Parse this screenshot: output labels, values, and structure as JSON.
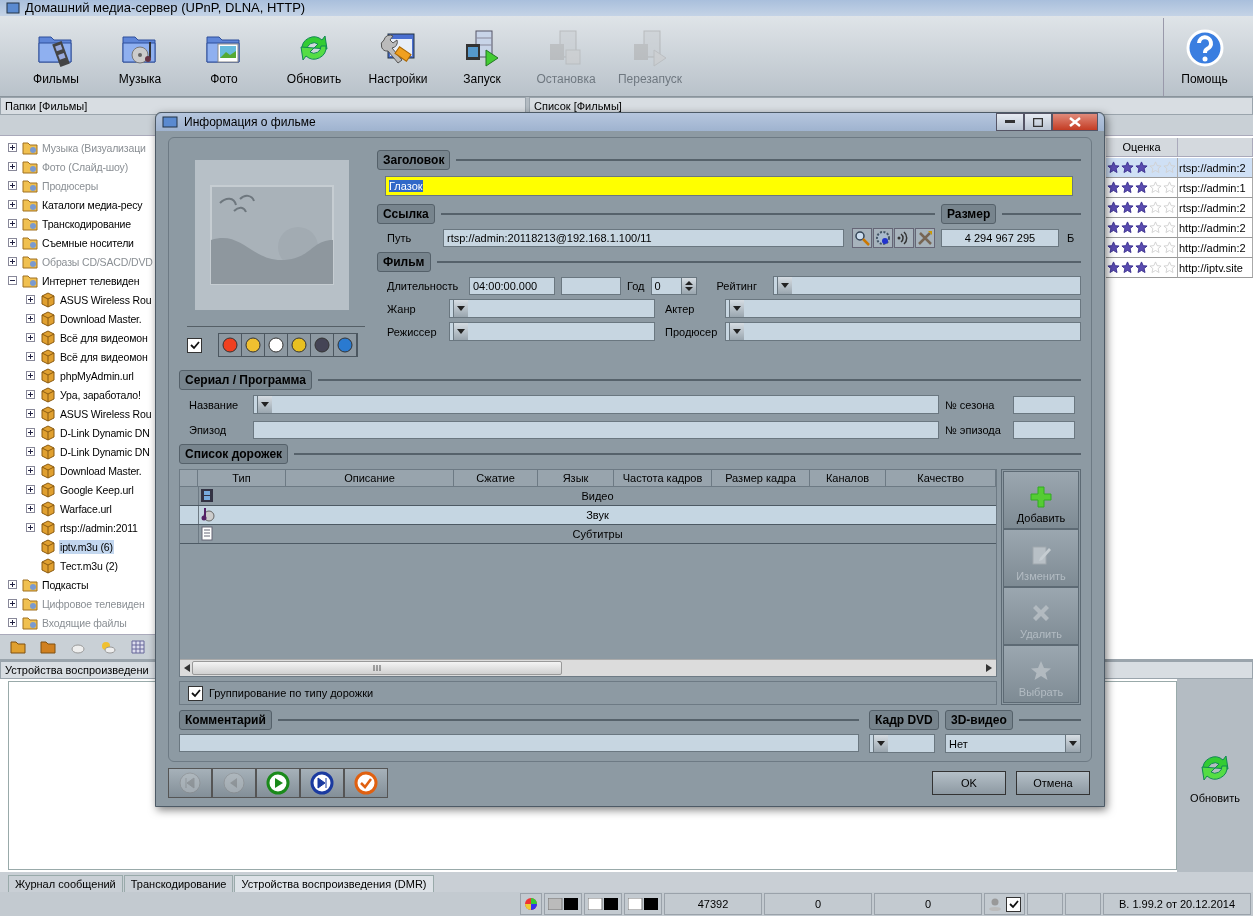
{
  "app": {
    "title": "Домашний медиа-сервер (UPnP, DLNA, HTTP)"
  },
  "toolbar": [
    {
      "label": "Фильмы",
      "disabled": false
    },
    {
      "label": "Музыка",
      "disabled": false
    },
    {
      "label": "Фото",
      "disabled": false
    },
    {
      "label": "Обновить",
      "disabled": false
    },
    {
      "label": "Настройки",
      "disabled": false
    },
    {
      "label": "Запуск",
      "disabled": false
    },
    {
      "label": "Остановка",
      "disabled": true
    },
    {
      "label": "Перезапуск",
      "disabled": true
    }
  ],
  "help_button": {
    "label": "Помощь"
  },
  "folders_panel": {
    "title": "Папки [Фильмы]",
    "tree": [
      {
        "label": "Музыка (Визуализаци",
        "dimmed": true,
        "expandable": true,
        "expanded": false,
        "selected": false
      },
      {
        "label": "Фото (Слайд-шоу)",
        "dimmed": true,
        "expandable": true,
        "expanded": false,
        "selected": false
      },
      {
        "label": "Продюсеры",
        "dimmed": true,
        "expandable": true,
        "expanded": false,
        "selected": false
      },
      {
        "label": "Каталоги медиа-ресу",
        "dimmed": false,
        "expandable": true,
        "expanded": false,
        "selected": false
      },
      {
        "label": "Транскодирование",
        "dimmed": false,
        "expandable": true,
        "expanded": false,
        "selected": false
      },
      {
        "label": "Съемные носители",
        "dimmed": false,
        "expandable": true,
        "expanded": false,
        "selected": false
      },
      {
        "label": "Образы CD/SACD/DVD",
        "dimmed": true,
        "expandable": true,
        "expanded": false,
        "selected": false
      },
      {
        "label": "Интернет телевиден",
        "dimmed": false,
        "expandable": true,
        "expanded": true,
        "selected": false,
        "children": [
          {
            "label": "ASUS Wireless Rou",
            "dimmed": false,
            "expandable": true,
            "expanded": false,
            "selected": false
          },
          {
            "label": "Download Master.",
            "dimmed": false,
            "expandable": true,
            "expanded": false,
            "selected": false
          },
          {
            "label": "Всё для видеомон",
            "dimmed": false,
            "expandable": true,
            "expanded": false,
            "selected": false
          },
          {
            "label": "Всё для видеомон",
            "dimmed": false,
            "expandable": true,
            "expanded": false,
            "selected": false
          },
          {
            "label": "phpMyAdmin.url",
            "dimmed": false,
            "expandable": true,
            "expanded": false,
            "selected": false
          },
          {
            "label": "Ура, заработало!",
            "dimmed": false,
            "expandable": true,
            "expanded": false,
            "selected": false
          },
          {
            "label": "ASUS Wireless Rou",
            "dimmed": false,
            "expandable": true,
            "expanded": false,
            "selected": false
          },
          {
            "label": "D-Link Dynamic DN",
            "dimmed": false,
            "expandable": true,
            "expanded": false,
            "selected": false
          },
          {
            "label": "D-Link Dynamic DN",
            "dimmed": false,
            "expandable": true,
            "expanded": false,
            "selected": false
          },
          {
            "label": "Download Master.",
            "dimmed": false,
            "expandable": true,
            "expanded": false,
            "selected": false
          },
          {
            "label": "Google Keep.url",
            "dimmed": false,
            "expandable": true,
            "expanded": false,
            "selected": false
          },
          {
            "label": "Warface.url",
            "dimmed": false,
            "expandable": true,
            "expanded": false,
            "selected": false
          },
          {
            "label": "rtsp://admin:2011",
            "dimmed": false,
            "expandable": true,
            "expanded": false,
            "selected": false
          },
          {
            "label": "iptv.m3u (6)",
            "dimmed": false,
            "expandable": false,
            "selected": true
          },
          {
            "label": "Тест.m3u (2)",
            "dimmed": false,
            "expandable": false,
            "selected": false
          }
        ]
      },
      {
        "label": "Подкасты",
        "dimmed": false,
        "expandable": true,
        "expanded": false,
        "selected": false
      },
      {
        "label": "Цифровое телевиден",
        "dimmed": true,
        "expandable": true,
        "expanded": false,
        "selected": false
      },
      {
        "label": "Входящие файлы",
        "dimmed": true,
        "expandable": true,
        "expanded": false,
        "selected": false
      }
    ]
  },
  "list_panel": {
    "title": "Список [Фильмы]",
    "columns": [
      "Оценка"
    ],
    "rows": [
      {
        "stars": 3,
        "link": "rtsp://admin:2",
        "selected": true
      },
      {
        "stars": 3,
        "link": "rtsp://admin:1",
        "selected": false
      },
      {
        "stars": 3,
        "link": "rtsp://admin:2",
        "selected": false
      },
      {
        "stars": 3,
        "link": "http://admin:2",
        "selected": false
      },
      {
        "stars": 3,
        "link": "http://admin:2",
        "selected": false
      },
      {
        "stars": 3,
        "link": "http://iptv.site",
        "selected": false
      }
    ]
  },
  "devices_panel": {
    "title": "Устройства воспроизведени",
    "refresh_button": "Обновить"
  },
  "bottom_tabs": [
    {
      "label": "Журнал сообщений",
      "selected": false
    },
    {
      "label": "Транскодирование",
      "selected": false
    },
    {
      "label": "Устройства воспроизведения (DMR)",
      "selected": true
    }
  ],
  "status_bar": {
    "counter_1": "47392",
    "counter_2": "0",
    "counter_3": "0",
    "checked": true,
    "version": "В. 1.99.2 от 20.12.2014"
  },
  "dialog": {
    "title": "Информация о фильме",
    "auto_fill_checked": true,
    "heading_section": {
      "label": "Заголовок",
      "value": "Глазок"
    },
    "link_section": {
      "label": "Ссылка",
      "path_label": "Путь",
      "path": "rtsp://admin:20118213@192.168.1.100/11"
    },
    "size_section": {
      "label": "Размер",
      "value": "4 294 967 295",
      "unit": "Б"
    },
    "film_section": {
      "label": "Фильм",
      "duration_label": "Длительность",
      "duration": "04:00:00.000",
      "year_label": "Год",
      "year": "0",
      "rating_label": "Рейтинг",
      "genre_label": "Жанр",
      "actor_label": "Актер",
      "director_label": "Режиссер",
      "producer_label": "Продюсер"
    },
    "series_section": {
      "label": "Сериал / Программа",
      "name_label": "Название",
      "season_label": "№ сезона",
      "episode_label": "Эпизод",
      "episode_no_label": "№ эпизода"
    },
    "tracks_section": {
      "label": "Список дорожек",
      "columns": [
        "Тип",
        "Описание",
        "Сжатие",
        "Язык",
        "Частота кадров",
        "Размер кадра",
        "Каналов",
        "Качество"
      ],
      "groups": [
        {
          "label": "Видео",
          "selected": false
        },
        {
          "label": "Звук",
          "selected": true
        },
        {
          "label": "Субтитры",
          "selected": false
        }
      ],
      "group_by_type": {
        "label": "Группирование по типу дорожки",
        "checked": true
      },
      "buttons": [
        {
          "label": "Добавить",
          "disabled": false
        },
        {
          "label": "Изменить",
          "disabled": true
        },
        {
          "label": "Удалить",
          "disabled": true
        },
        {
          "label": "Выбрать",
          "disabled": true
        }
      ]
    },
    "comment_section": {
      "label": "Комментарий"
    },
    "dvd_frame_section": {
      "label": "Кадр DVD"
    },
    "video_3d_section": {
      "label": "3D-видео",
      "value": "Нет"
    },
    "nav_buttons": [
      {
        "disabled": true
      },
      {
        "disabled": true
      },
      {
        "disabled": false
      },
      {
        "disabled": false
      },
      {
        "disabled": false
      }
    ],
    "ok_button": "OK",
    "cancel_button": "Отмена"
  }
}
